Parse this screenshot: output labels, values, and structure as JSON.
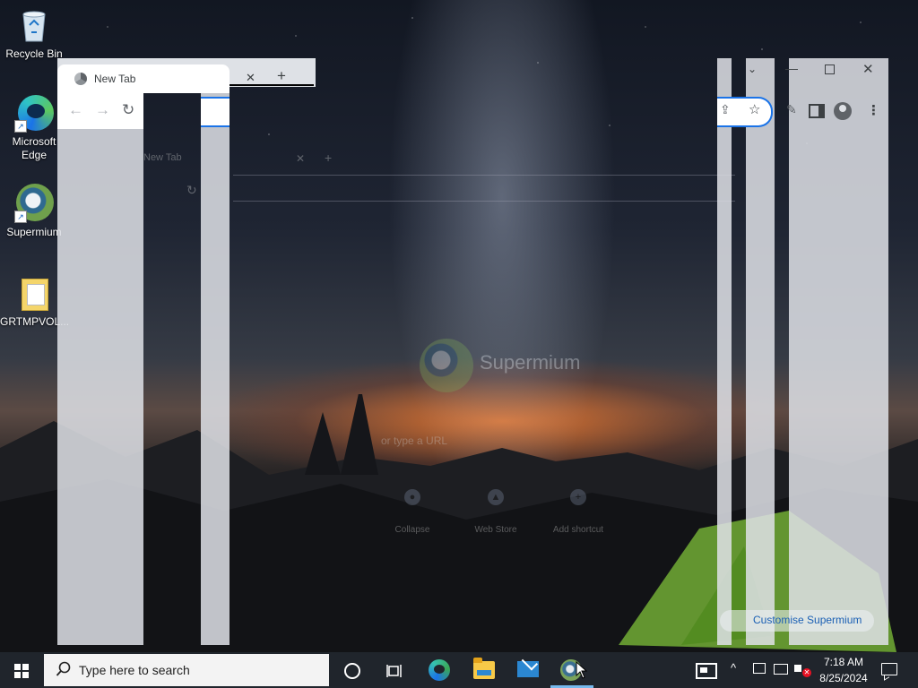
{
  "desktop": {
    "icons": [
      {
        "label": "Recycle Bin",
        "icon": "recycle-bin-icon"
      },
      {
        "label": "Microsoft Edge",
        "icon": "edge-icon",
        "shortcut": true
      },
      {
        "label": "Supermium",
        "icon": "supermium-icon",
        "shortcut": true
      },
      {
        "label": "GRTMPVOL...",
        "icon": "folder-icon"
      }
    ]
  },
  "browser": {
    "tab_title": "New Tab",
    "brand_name": "Supermium",
    "search_placeholder": "or type a URL",
    "shortcuts": [
      {
        "label": "Collapse",
        "icon": "shortcut-icon"
      },
      {
        "label": "Web Store",
        "icon": "web-store-icon"
      },
      {
        "label": "Add shortcut",
        "icon": "plus-icon"
      }
    ],
    "customise_label": "Customise Supermium",
    "accent_color": "#1a73e8"
  },
  "taskbar": {
    "search_placeholder": "Type here to search",
    "apps": [
      "cortana-icon",
      "task-view-icon",
      "edge-icon",
      "file-explorer-icon",
      "mail-icon",
      "supermium-icon"
    ],
    "active_app": "supermium-icon",
    "time": "7:18 AM",
    "date": "8/25/2024"
  }
}
